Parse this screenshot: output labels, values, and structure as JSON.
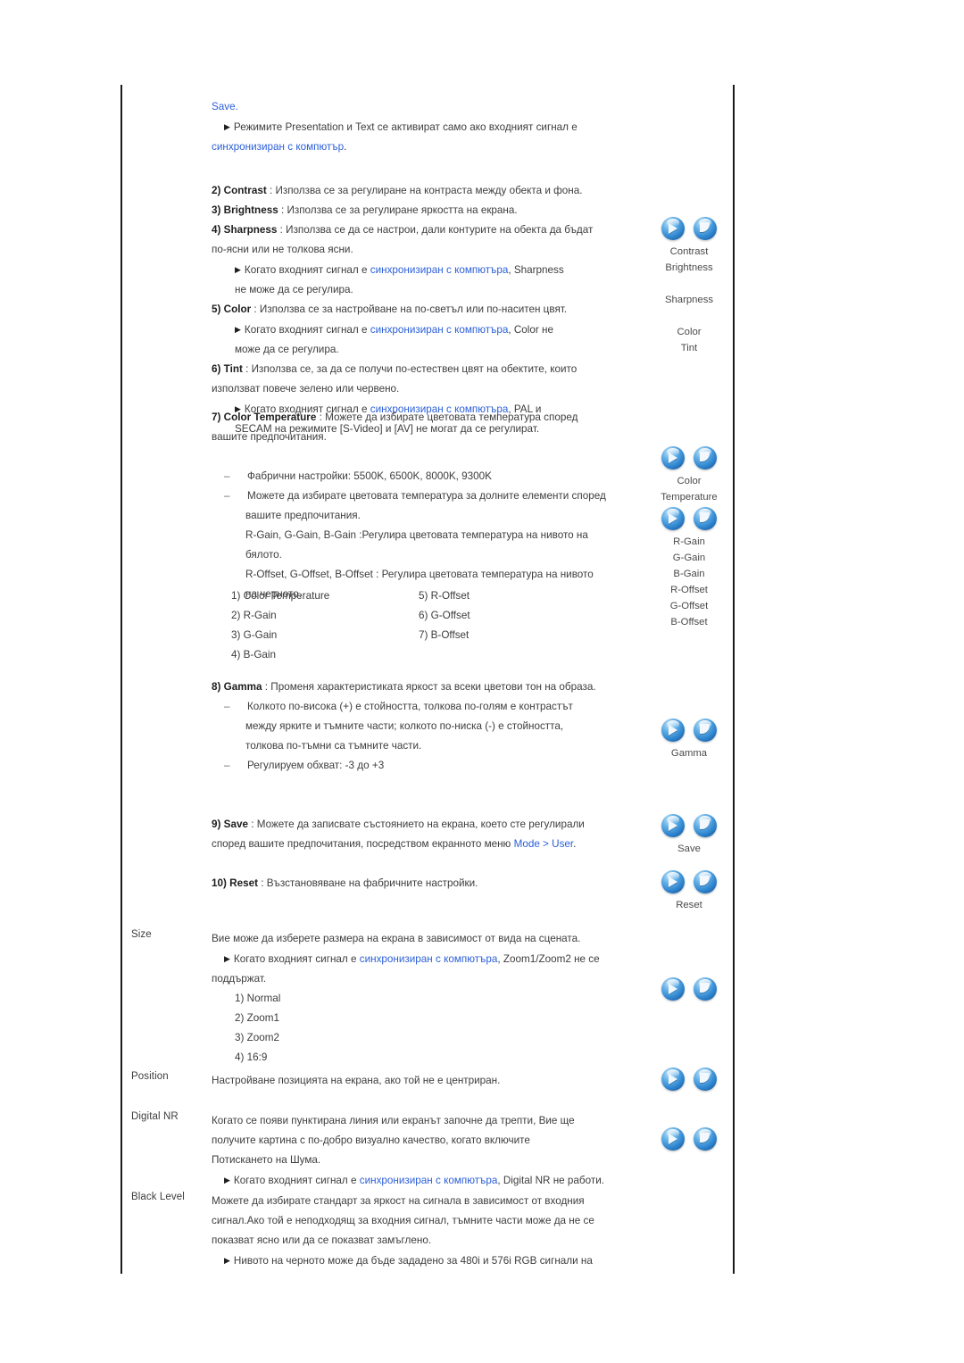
{
  "document": {
    "language": "bg",
    "link_color": "#2b5fd9",
    "text_color": "#3d3d3d"
  },
  "intro": {
    "save_link": "Save.",
    "note_arrow": "▶",
    "note_text_a": "Режимите Presentation и Text се активират само ако входният сигнал е",
    "note_link": "синхронизиран с компютър",
    "note_text_b": "."
  },
  "items": {
    "contrast": {
      "num": "2)",
      "name": "Contrast",
      "sep": " : ",
      "desc": "Използва се за регулиране на контраста между обекта и фона."
    },
    "brightness": {
      "num": "3)",
      "name": "Brightness",
      "sep": " : ",
      "desc": "Използва се за регулиране яркостта на екрана."
    },
    "sharpness": {
      "num": "4)",
      "name": "Sharpness",
      "sep": " : ",
      "desc_line1": "Използва се да се настрои, дали контурите на обекта да бъдат",
      "desc_line2": "по-ясни или не толкова ясни.",
      "note_a": "Когато входният сигнал е ",
      "note_link": "синхронизиран с компютъра",
      "note_b": ", Sharpness",
      "note_c": "не може да се регулира."
    },
    "color": {
      "num": "5)",
      "name": "Color",
      "sep": " : ",
      "desc": "Използва се за настройване на по-светъл или по-наситен цвят.",
      "note_a": "Когато входният сигнал е ",
      "note_link": "синхронизиран с компютъра",
      "note_b": ", Color не",
      "note_c": "може да се регулира."
    },
    "tint": {
      "num": "6)",
      "name": "Tint",
      "sep": " : ",
      "desc_line1": "Използва се, за да се получи по-естествен цвят на обектите, които",
      "desc_line2": "използват повече зелено или червено.",
      "note_a": "Когато входният сигнал е ",
      "note_link": "синхронизиран с компютъра",
      "note_b": ", PAL и",
      "note_c": "SECAM на режимите [S-Video] и [AV] не могат да се регулират."
    },
    "color_temperature": {
      "num": "7)",
      "name": "Color Temperature",
      "sep": " : ",
      "desc_line1": "Можете да избирате цветовата температура според",
      "desc_line2": "вашите предпочитания.",
      "bullets": [
        "Фабрични настройки: 5500K, 6500K, 8000K, 9300K",
        "Можете да избирате цветовата температура за долните елементи според"
      ],
      "cont_line1": "вашите предпочитания.",
      "cont_line2": "R-Gain, G-Gain, B-Gain :Регулира цветовата температура на нивото на",
      "cont_line3": "бялото.",
      "cont_line4": "R-Offset, G-Offset, B-Offset : Регулира цветовата температура на нивото",
      "cont_line5": "на черното.",
      "sub_items_left": [
        "1) Color Temperature",
        "2) R-Gain",
        "3) G-Gain",
        "4) B-Gain"
      ],
      "sub_items_right": [
        "5) R-Offset",
        "6) G-Offset",
        "7) B-Offset",
        ""
      ]
    },
    "gamma": {
      "num": "8)",
      "name": "Gamma",
      "sep": " : ",
      "desc": "Променя характеристиката яркост за всеки цветови тон на образа.",
      "bullet1_line1": "Колкото по-висока (+) е стойността, толкова по-голям е контрастът",
      "bullet1_line2": "между ярките и тъмните части; колкото по-ниска (-) е стойността,",
      "bullet1_line3": "толкова по-тъмни са тъмните части.",
      "bullet2": "Регулируем обхват: -3 до +3"
    },
    "save": {
      "num": "9)",
      "name": "Save",
      "sep": " : ",
      "desc_line1": "Можете да записвате състоянието на екрана, което сте регулирали",
      "desc_line2_a": "според вашите предпочитания, посредством екранното меню ",
      "desc_line2_link": "Mode > User",
      "desc_line2_b": "."
    },
    "reset": {
      "num": "10)",
      "name": "Reset",
      "sep": " : ",
      "desc": "Възстановяване на фабричните настройки."
    },
    "size": {
      "label": "Size",
      "desc": "Вие може да изберете размера на екрана в зависимост от вида на сцената.",
      "note_a": "Когато входният сигнал е ",
      "note_link": "синхронизиран с компютъра",
      "note_b": ", Zoom1/Zoom2 не се",
      "note_c": "поддържат.",
      "options": [
        "1) Normal",
        "2) Zoom1",
        "3) Zoom2",
        "4) 16:9"
      ]
    },
    "position": {
      "label": "Position",
      "desc": "Настройване позицията на екрана, ако той не е центриран."
    },
    "digital_nr": {
      "label": "Digital NR",
      "desc_line1": "Когато се появи пунктирана линия или екранът започне да трепти, Вие ще",
      "desc_line2": "получите картина с по-добро визуално качество, когато включите",
      "desc_line3": "Потискането на Шума.",
      "note_a": "Когато входният сигнал е ",
      "note_link": "синхронизиран с компютъра",
      "note_b": ", Digital NR не работи."
    },
    "black_level": {
      "label": "Black Level",
      "desc_line1": "Можете да избирате стандарт за яркост на сигнала в зависимост от входния",
      "desc_line2": "сигнал.Ако той е неподходящ за входния сигнал, тъмните части може да не се",
      "desc_line3": "показват ясно или да се показват замъглено.",
      "note": "Нивото на черното може да бъде зададено за 480i и 576i RGB сигнали на"
    }
  },
  "icon_groups": [
    {
      "id": "contrast-brightness-sharpness-color-tint",
      "labels": [
        "Contrast",
        "Brightness",
        "",
        "Sharpness",
        "",
        "Color",
        "Tint"
      ]
    },
    {
      "id": "color-temperature",
      "labels": [
        "Color",
        "Temperature"
      ]
    },
    {
      "id": "gain-offset",
      "labels": [
        "R-Gain",
        "G-Gain",
        "B-Gain",
        "R-Offset",
        "G-Offset",
        "B-Offset"
      ]
    },
    {
      "id": "gamma",
      "labels": [
        "Gamma"
      ]
    },
    {
      "id": "save",
      "labels": [
        "Save"
      ]
    },
    {
      "id": "reset",
      "labels": [
        "Reset"
      ]
    },
    {
      "id": "size",
      "labels": []
    },
    {
      "id": "position",
      "labels": []
    },
    {
      "id": "digital-nr",
      "labels": []
    }
  ],
  "icons": {
    "left_glyph": "play-orb-icon",
    "right_glyph": "corner-orb-icon"
  }
}
